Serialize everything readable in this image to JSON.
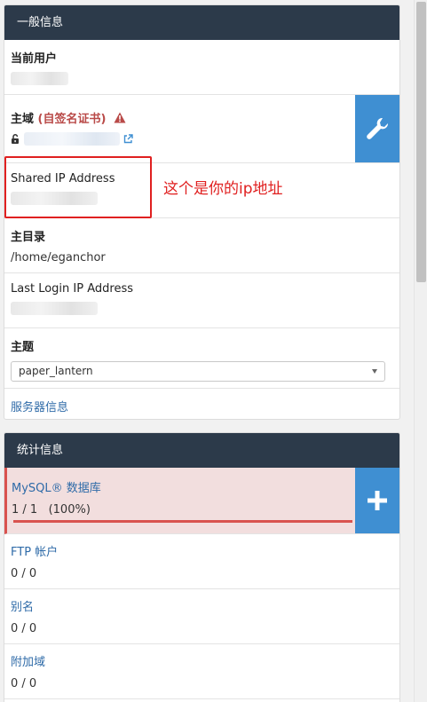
{
  "general": {
    "header": "一般信息",
    "current_user_label": "当前用户",
    "domain_label": "主域",
    "domain_note": "(自签名证书)",
    "shared_ip_label": "Shared IP Address",
    "home_label": "主目录",
    "home_value": "/home/eganchor",
    "last_login_label": "Last Login IP Address",
    "theme_label": "主题",
    "theme_value": "paper_lantern",
    "server_info_link": "服务器信息"
  },
  "annotation": "这个是你的ip地址",
  "stats": {
    "header": "统计信息",
    "items": [
      {
        "label": "MySQL® 数据库",
        "value": "1 / 1   (100%)",
        "usage_fraction": 1.0
      },
      {
        "label": "FTP 帐户",
        "value": "0 / 0"
      },
      {
        "label": "别名",
        "value": "0 / 0"
      },
      {
        "label": "附加域",
        "value": "0 / 0"
      }
    ]
  },
  "colors": {
    "header_bg": "#2c3a4a",
    "action_blue": "#3f8fd2",
    "danger": "#d9534f",
    "annotation_red": "#e02020",
    "link": "#2f6ba8"
  },
  "icons": {
    "domain_action": "wrench-icon",
    "stats_action": "plus-icon",
    "warning": "warning-icon",
    "lock": "unlock-icon",
    "external": "external-link-icon"
  }
}
